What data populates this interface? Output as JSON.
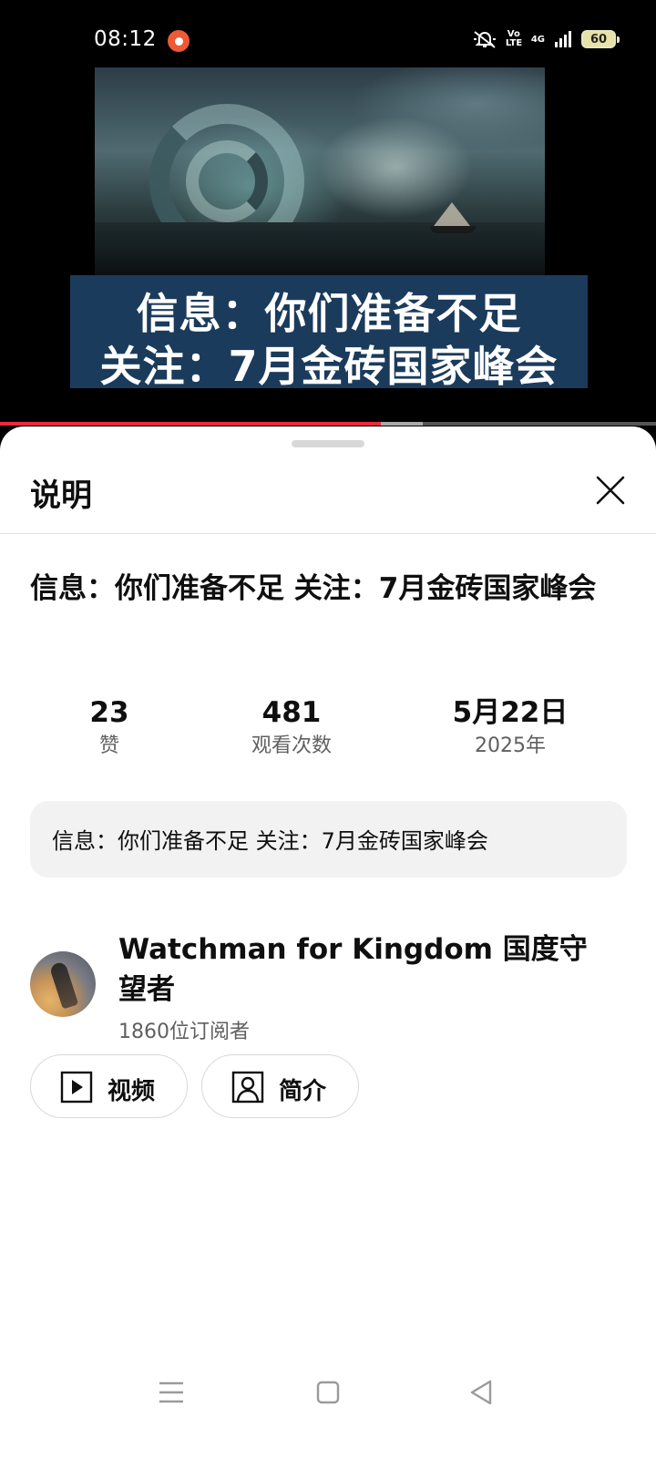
{
  "status_bar": {
    "time": "08:12",
    "icons": [
      "screen-record-icon",
      "mute-icon",
      "volte-icon",
      "signal-4g-icon"
    ],
    "volte_label": "Vo\nLTE",
    "network_label": "4G",
    "battery_level": "60"
  },
  "video": {
    "caption_line1": "信息：你们准备不足",
    "caption_line2": "关注：7月金砖国家峰会",
    "progress_played_fraction": 0.58,
    "progress_buffered_fraction": 0.645,
    "colors": {
      "played": "#f0283c",
      "caption_bg": "#1b3b5c"
    }
  },
  "sheet": {
    "title": "说明",
    "video_title": "信息：你们准备不足 关注：7月金砖国家峰会",
    "stats": [
      {
        "value": "23",
        "label": "赞"
      },
      {
        "value": "481",
        "label": "观看次数"
      },
      {
        "value": "5月22日",
        "label": "2025年"
      }
    ],
    "description": "信息：你们准备不足 关注：7月金砖国家峰会",
    "channel": {
      "name": "Watchman for Kingdom 国度守望者",
      "subscribers": "1860位订阅者"
    },
    "buttons": [
      {
        "label": "视频",
        "icon": "play-box-icon"
      },
      {
        "label": "简介",
        "icon": "person-box-icon"
      }
    ]
  },
  "nav_bar": {
    "icons": [
      "menu-icon",
      "home-icon",
      "back-icon"
    ]
  }
}
